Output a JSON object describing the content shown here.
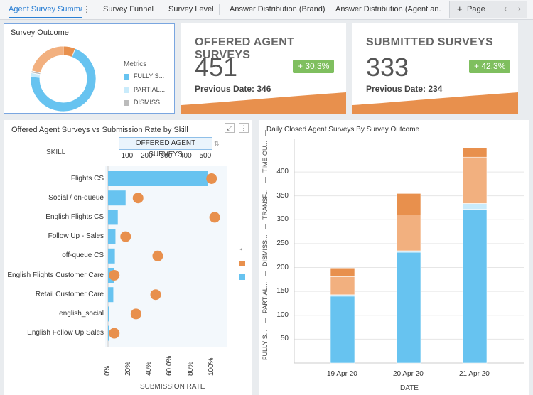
{
  "colors": {
    "blue": "#67c3f0",
    "orange": "#e8904d",
    "light_orange": "#f2b07f",
    "light_blue": "#c9ebfb",
    "gray": "#cccccc",
    "green_badge": "#7fbf5f",
    "accent": "#2a7fd4"
  },
  "tabs": [
    {
      "label": "Agent Survey Summary",
      "active": true
    },
    {
      "label": "Survey Funnel",
      "active": false
    },
    {
      "label": "Survey Level",
      "active": false
    },
    {
      "label": "Answer Distribution (Brand)",
      "active": false
    },
    {
      "label": "Answer Distribution (Agent an...",
      "active": false
    }
  ],
  "tab_kebab": "⋮",
  "page_button": {
    "plus": "+",
    "label": "Page",
    "prev": "‹",
    "next": "›"
  },
  "survey_outcome": {
    "title": "Survey Outcome",
    "legend_title": "Metrics",
    "legend": [
      {
        "label": "FULLY S...",
        "color": "#67c3f0"
      },
      {
        "label": "PARTIAL...",
        "color": "#c9ebfb"
      },
      {
        "label": "DISMISS...",
        "color": "#bbbbbb"
      }
    ],
    "chart_data": {
      "type": "pie",
      "slices": [
        {
          "name": "FULLY S...",
          "value": 70,
          "color": "#67c3f0"
        },
        {
          "name": "PARTIAL...",
          "value": 2,
          "color": "#c9ebfb"
        },
        {
          "name": "DISMISS...",
          "value": 1,
          "color": "#bbbbbb"
        },
        {
          "name": "PARTIAL (orange)",
          "value": 21,
          "color": "#f2b07f"
        },
        {
          "name": "TIME OUT (orange)",
          "value": 6,
          "color": "#e8904d"
        }
      ]
    }
  },
  "kpis": [
    {
      "title": "OFFERED AGENT SURVEYS",
      "value": "451",
      "badge": "+ 30.3%",
      "prev_label": "Previous Date: 346"
    },
    {
      "title": "SUBMITTED SURVEYS",
      "value": "333",
      "badge": "+ 42.3%",
      "prev_label": "Previous Date: 234"
    }
  ],
  "skill_chart": {
    "title": "Offered Agent Surveys vs Submission Rate by Skill",
    "skill_header": "SKILL",
    "top_axis_label": "OFFERED AGENT SURVEYS",
    "bottom_axis_label": "SUBMISSION RATE",
    "expand_icon": "⤢",
    "menu_icon": "⋮",
    "collapse_icon": "◂",
    "chart_data": {
      "type": "bar",
      "categories": [
        "Flights CS",
        "Social / on-queue",
        "English Flights CS",
        "Follow Up - Sales",
        "off-queue CS",
        "English Flights Customer Care",
        "Retail Customer Care",
        "english_social",
        "English Follow Up Sales"
      ],
      "series": [
        {
          "name": "OFFERED AGENT SURVEYS",
          "values": [
            512,
            90,
            50,
            38,
            35,
            30,
            27,
            5,
            3
          ]
        },
        {
          "name": "SUBMISSION RATE",
          "values": [
            1.0,
            0.29,
            1.03,
            0.17,
            0.48,
            0.06,
            0.46,
            0.27,
            0.06
          ]
        }
      ],
      "top_ticks": [
        "100",
        "200",
        "300",
        "400",
        "500"
      ],
      "top_range": [
        0,
        520
      ],
      "bottom_ticks": [
        "0%",
        "20%",
        "40%",
        "60.0%",
        "80%",
        "100%"
      ],
      "bottom_range": [
        0,
        1.05
      ]
    }
  },
  "daily_chart": {
    "title": "Daily Closed Agent Surveys By Survey Outcome",
    "xlabel": "DATE",
    "legend_vertical": [
      "FULLY S...",
      "PARTIAL...",
      "DISMISS...",
      "TRANSF...",
      "TIME OU..."
    ],
    "chart_data": {
      "type": "bar",
      "categories": [
        "19 Apr 20",
        "20 Apr 20",
        "21 Apr 20"
      ],
      "ylim": [
        0,
        470
      ],
      "yticks": [
        "50",
        "100",
        "150",
        "200",
        "250",
        "300",
        "350",
        "400"
      ],
      "series": [
        {
          "name": "FULLY S...",
          "values": [
            140,
            232,
            322
          ],
          "color": "#67c3f0"
        },
        {
          "name": "PARTIAL...",
          "values": [
            3,
            3,
            12
          ],
          "color": "#c9ebfb"
        },
        {
          "name": "DISMISS...",
          "values": [
            0,
            0,
            0
          ],
          "color": "#bbbbbb"
        },
        {
          "name": "TRANSF...",
          "values": [
            38,
            75,
            97
          ],
          "color": "#f2b07f"
        },
        {
          "name": "TIME OU...",
          "values": [
            18,
            45,
            20
          ],
          "color": "#e8904d"
        }
      ]
    }
  }
}
